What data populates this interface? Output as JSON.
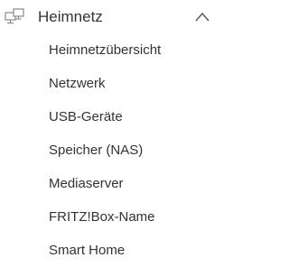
{
  "nav_group": {
    "icon": "network-icon",
    "label": "Heimnetz",
    "toggle_icon": "chevron-up-icon",
    "expanded": true,
    "items": [
      {
        "label": "Heimnetzübersicht"
      },
      {
        "label": "Netzwerk"
      },
      {
        "label": "USB-Geräte"
      },
      {
        "label": "Speicher (NAS)"
      },
      {
        "label": "Mediaserver"
      },
      {
        "label": "FRITZ!Box-Name"
      },
      {
        "label": "Smart Home"
      }
    ]
  },
  "colors": {
    "text": "#333333",
    "icon": "#8a8a8a",
    "background": "#ffffff"
  }
}
